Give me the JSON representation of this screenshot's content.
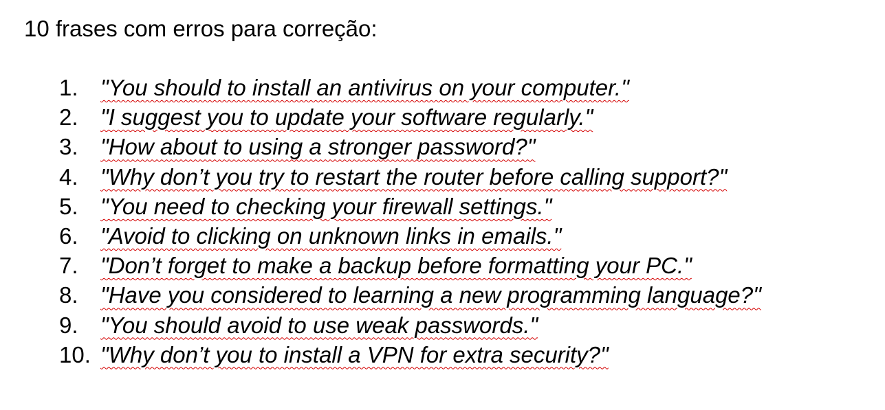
{
  "document": {
    "title": "10 frases com erros para correção:",
    "sentences": [
      {
        "number": "1.",
        "text": "\"You should to install an antivirus on your computer.\""
      },
      {
        "number": "2.",
        "text": "\"I suggest you to update your software regularly.\""
      },
      {
        "number": "3.",
        "text": "\"How about to using a stronger password?\""
      },
      {
        "number": "4.",
        "text": "\"Why don’t you try to restart the router before calling support?\""
      },
      {
        "number": "5.",
        "text": "\"You need to checking your firewall settings.\""
      },
      {
        "number": "6.",
        "text": "\"Avoid to clicking on unknown links in emails.\""
      },
      {
        "number": "7.",
        "text": "\"Don’t forget to make a backup before formatting your PC.\""
      },
      {
        "number": "8.",
        "text": "\"Have you considered to learning a new programming language?\""
      },
      {
        "number": "9.",
        "text": "\"You should avoid to use weak passwords.\""
      },
      {
        "number": "10.",
        "text": "\"Why don’t you to install a VPN for extra security?\""
      }
    ]
  },
  "colors": {
    "text": "#000000",
    "spellcheck_underline": "#d40000",
    "background": "#ffffff"
  }
}
